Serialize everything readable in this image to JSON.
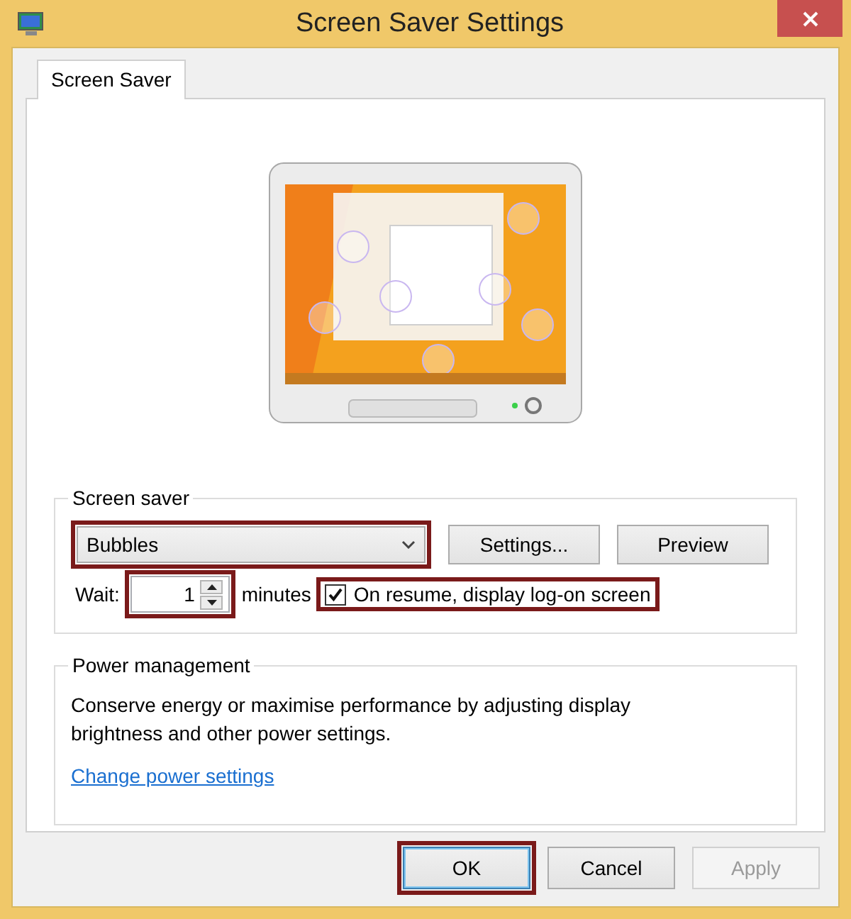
{
  "window": {
    "title": "Screen Saver Settings"
  },
  "tabs": [
    {
      "label": "Screen Saver",
      "selected": true
    }
  ],
  "screen_saver": {
    "group_label": "Screen saver",
    "dropdown": {
      "value": "Bubbles",
      "highlighted": true
    },
    "buttons": [
      {
        "label": "Settings..."
      },
      {
        "label": "Preview"
      }
    ],
    "wait_label": "Wait:",
    "wait": {
      "value": "1",
      "highlighted": true
    },
    "minutes_label": "minutes",
    "resume_checkbox": {
      "label": "On resume, display log-on screen",
      "checked": true,
      "highlighted": true
    }
  },
  "power": {
    "group_label": "Power management",
    "description": "Conserve energy or maximise performance by adjusting display brightness and other power settings.",
    "link": "Change power settings"
  },
  "buttons": [
    {
      "label": "OK",
      "default": true,
      "disabled": false,
      "highlighted": true
    },
    {
      "label": "Cancel",
      "default": false,
      "disabled": false,
      "highlighted": false
    },
    {
      "label": "Apply",
      "default": false,
      "disabled": true,
      "highlighted": false
    }
  ]
}
